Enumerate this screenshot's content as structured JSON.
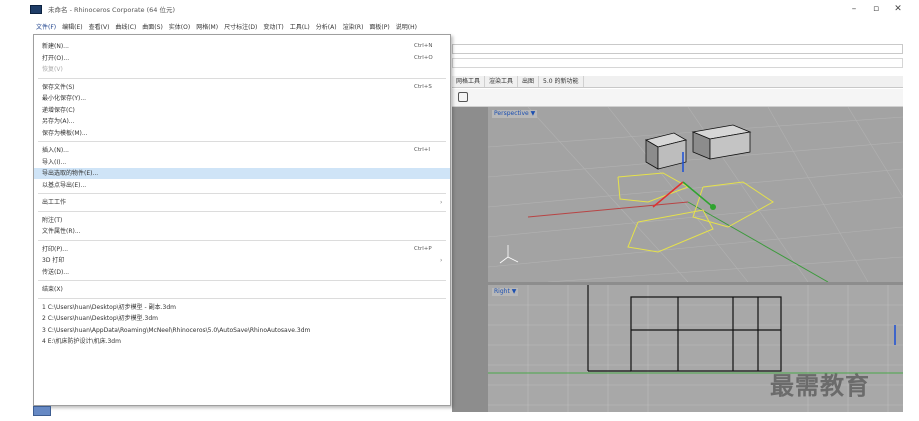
{
  "window": {
    "title": "未命名 - Rhinoceros Corporate (64 位元)",
    "controls": [
      "–",
      "▫",
      "✕"
    ]
  },
  "menubar": [
    "文件(F)",
    "编辑(E)",
    "查看(V)",
    "曲线(C)",
    "曲面(S)",
    "实体(O)",
    "网格(M)",
    "尺寸标注(D)",
    "变动(T)",
    "工具(L)",
    "分析(A)",
    "渲染(R)",
    "面板(P)",
    "说明(H)"
  ],
  "tabs": [
    "网格工具",
    "渲染工具",
    "出图",
    "5.0 的新功能"
  ],
  "viewports": {
    "perspective": "Perspective ▼",
    "right": "Right ▼"
  },
  "file_menu": [
    {
      "label": "新建(N)...",
      "shortcut": "Ctrl+N"
    },
    {
      "label": "打开(O)...",
      "shortcut": "Ctrl+O"
    },
    {
      "label": "恢复(V)",
      "shortcut": "",
      "disabled": true
    },
    {
      "sep": true
    },
    {
      "label": "保存文件(S)",
      "shortcut": "Ctrl+S"
    },
    {
      "label": "最小化保存(Y)...",
      "shortcut": ""
    },
    {
      "label": "递增保存(C)",
      "shortcut": ""
    },
    {
      "label": "另存为(A)...",
      "shortcut": ""
    },
    {
      "label": "保存为模板(M)...",
      "shortcut": ""
    },
    {
      "sep": true
    },
    {
      "label": "插入(N)...",
      "shortcut": "Ctrl+I"
    },
    {
      "label": "导入(I)...",
      "shortcut": ""
    },
    {
      "label": "导出选取的物件(E)...",
      "shortcut": "",
      "highlight": true
    },
    {
      "label": "以基点导出(E)...",
      "shortcut": ""
    },
    {
      "sep": true
    },
    {
      "label": "出工工作",
      "shortcut": "",
      "submenu": true
    },
    {
      "sep": true
    },
    {
      "label": "附注(T)",
      "shortcut": ""
    },
    {
      "label": "文件属性(R)...",
      "shortcut": ""
    },
    {
      "sep": true
    },
    {
      "label": "打印(P)...",
      "shortcut": "Ctrl+P"
    },
    {
      "label": "3D 打印",
      "shortcut": "",
      "submenu": true
    },
    {
      "label": "传送(D)...",
      "shortcut": ""
    },
    {
      "sep": true
    },
    {
      "label": "结束(X)",
      "shortcut": ""
    },
    {
      "sep": true
    },
    {
      "label": "1 C:\\Users\\huan\\Desktop\\初步模型 - 副本.3dm",
      "shortcut": ""
    },
    {
      "label": "2 C:\\Users\\huan\\Desktop\\初步模型.3dm",
      "shortcut": ""
    },
    {
      "label": "3 C:\\Users\\huan\\AppData\\Roaming\\McNeel\\Rhinoceros\\5.0\\AutoSave\\RhinoAutosave.3dm",
      "shortcut": ""
    },
    {
      "label": "4 E:\\机床防护设计\\机床.3dm",
      "shortcut": ""
    }
  ],
  "watermark": "最需教育"
}
